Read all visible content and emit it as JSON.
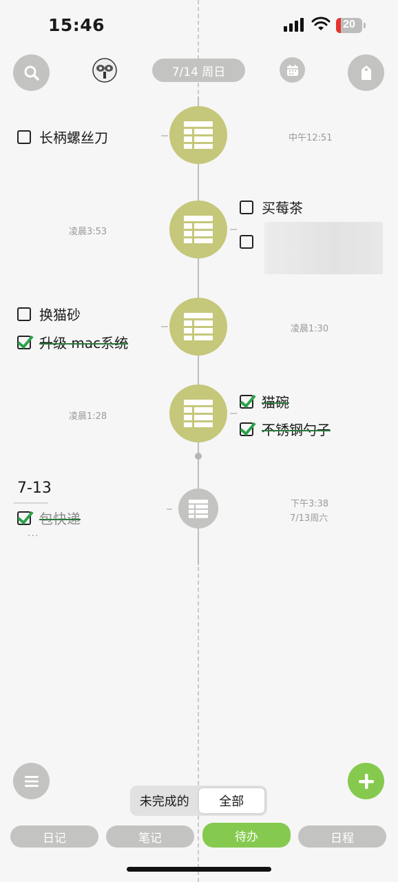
{
  "status": {
    "time": "15:46",
    "battery": "20"
  },
  "header": {
    "date": "7/14 周日"
  },
  "icons": {
    "search": "search-icon",
    "avatar": "robot-avatar",
    "calendar": "calendar-icon",
    "tag": "tag-icon",
    "menu": "menu-icon",
    "add": "plus-icon",
    "node": "list-grid-icon"
  },
  "groups": [
    {
      "time": "中午12:51",
      "tasks": [
        {
          "label": "长柄螺丝刀",
          "done": false
        }
      ]
    },
    {
      "time": "凌晨3:53",
      "tasks": [
        {
          "label": "买莓茶",
          "done": false
        },
        {
          "label": "",
          "done": false
        }
      ]
    },
    {
      "time": "凌晨1:30",
      "tasks": [
        {
          "label": "换猫砂",
          "done": false
        },
        {
          "label": "升级 mac系统",
          "done": true
        }
      ]
    },
    {
      "time": "凌晨1:28",
      "tasks": [
        {
          "label": "猫碗",
          "done": true
        },
        {
          "label": "不锈钢勺子",
          "done": true
        }
      ]
    }
  ],
  "previous_day": {
    "title": "7-13",
    "time": "下午3:38",
    "date": "7/13周六",
    "tasks": [
      {
        "label": "包快递",
        "done": true
      }
    ],
    "more": "···"
  },
  "filter": {
    "options": [
      "未完成的",
      "全部"
    ],
    "selected": "全部"
  },
  "tabs": [
    {
      "label": "日记",
      "active": false
    },
    {
      "label": "笔记",
      "active": false
    },
    {
      "label": "待办",
      "active": true
    },
    {
      "label": "日程",
      "active": false
    }
  ],
  "colors": {
    "accent": "#86c94f",
    "node": "#c5c77a",
    "pill": "#c3c3c1",
    "check": "#2aa24a"
  }
}
